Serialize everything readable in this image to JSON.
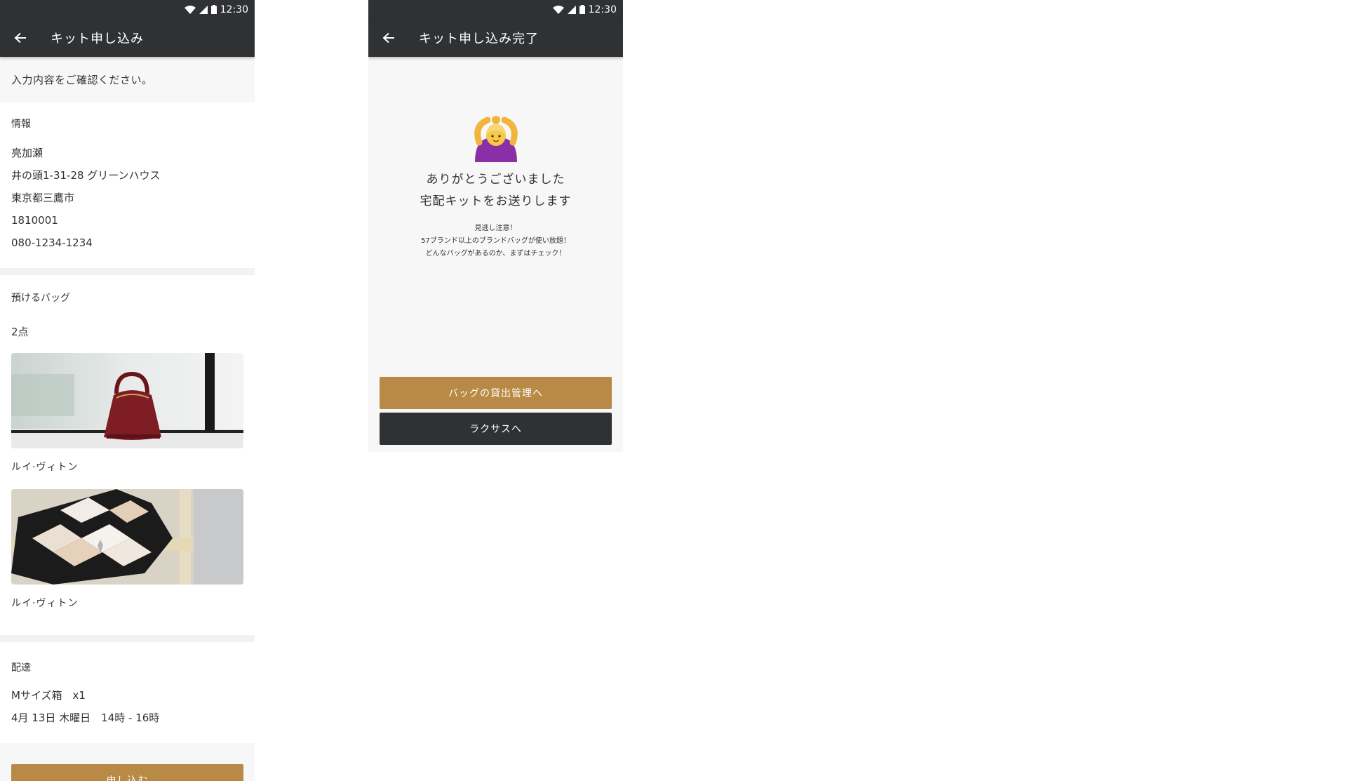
{
  "left": {
    "status": {
      "time": "12:30"
    },
    "appbar": {
      "title": "キット申し込み"
    },
    "confirm_message": "入力内容をご確認ください。",
    "info": {
      "label": "情報",
      "name": "亮加瀬",
      "address1": "井の頭1-31-28 グリーンハウス",
      "address2": "東京都三鷹市",
      "postal": "1810001",
      "phone": "080-1234-1234"
    },
    "bags": {
      "label": "預けるバッグ",
      "count": "2点",
      "items": [
        {
          "brand": "ルイ·ヴィトン"
        },
        {
          "brand": "ルイ·ヴィトン"
        }
      ]
    },
    "delivery": {
      "label": "配達",
      "box": "Mサイズ箱　x1",
      "datetime": "4月 13日 木曜日　14時 - 16時"
    },
    "submit_label": "申し込む"
  },
  "right": {
    "status": {
      "time": "12:30"
    },
    "appbar": {
      "title": "キット申し込み完了"
    },
    "emoji_icon": "person-gesturing-ok-icon",
    "thanks_line1": "ありがとうございました",
    "thanks_line2": "宅配キットをお送りします",
    "note1": "見逃し注意！",
    "note2": "57ブランド以上のブランドバッグが使い放題！",
    "note3": "どんなバッグがあるのか、まずはチェック！",
    "button_primary": "バッグの貸出管理へ",
    "button_secondary": "ラクサスへ"
  },
  "colors": {
    "appbar": "#2f3133",
    "accent_gold": "#b88a45",
    "background": "#f7f7f7"
  }
}
